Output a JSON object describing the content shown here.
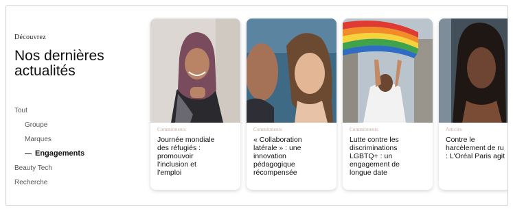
{
  "section": {
    "eyebrow": "Découvrez",
    "title": "Nos dernières actualités"
  },
  "filters": [
    {
      "label": "Tout"
    },
    {
      "label": "Groupe"
    },
    {
      "label": "Marques"
    },
    {
      "label": "Engagements"
    },
    {
      "label": "Beauty Tech"
    },
    {
      "label": "Recherche"
    }
  ],
  "cards": [
    {
      "category": "Commitments",
      "title": "Journée mondiale\ndes réfugiés :\npromouvoir\nl'inclusion et\nl'emploi"
    },
    {
      "category": "Commitments",
      "title": "« Collaboration\nlatérale » : une\ninnovation\npédagogique\nrécompensée"
    },
    {
      "category": "Commitments",
      "title": "Lutte contre les\ndiscriminations\nLGBTQ+ : un\nengagement de\nlongue date"
    },
    {
      "category": "Articles",
      "title": "Contre le\nharcèlement de ru\n: L'Oréal Paris agit"
    }
  ],
  "colors": {
    "accent": "#111111",
    "category": "#c3a89a"
  },
  "carousel": {
    "scroll_fraction": 0.4
  }
}
